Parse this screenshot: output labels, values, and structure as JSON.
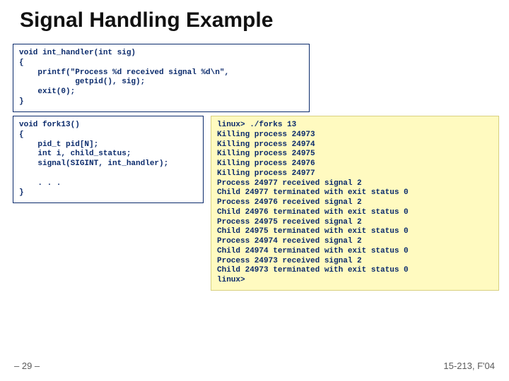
{
  "title": "Signal Handling Example",
  "code_top": "void int_handler(int sig)\n{\n    printf(\"Process %d received signal %d\\n\",\n            getpid(), sig);\n    exit(0);\n}",
  "code_mid": "void fork13()\n{\n    pid_t pid[N];\n    int i, child_status;\n    signal(SIGINT, int_handler);\n\n    . . .\n}",
  "output": "linux> ./forks 13\nKilling process 24973\nKilling process 24974\nKilling process 24975\nKilling process 24976\nKilling process 24977\nProcess 24977 received signal 2\nChild 24977 terminated with exit status 0\nProcess 24976 received signal 2\nChild 24976 terminated with exit status 0\nProcess 24975 received signal 2\nChild 24975 terminated with exit status 0\nProcess 24974 received signal 2\nChild 24974 terminated with exit status 0\nProcess 24973 received signal 2\nChild 24973 terminated with exit status 0\nlinux>",
  "footer": {
    "left": "– 29 –",
    "right": "15-213, F'04"
  }
}
